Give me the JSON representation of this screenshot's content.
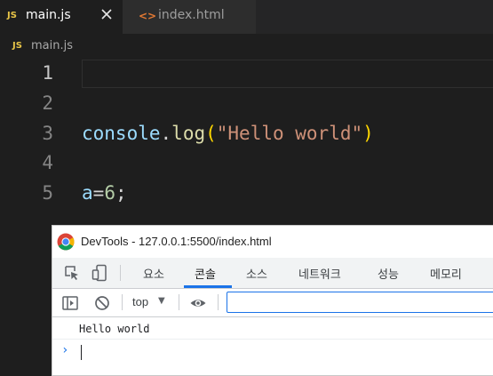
{
  "editor": {
    "tabs": [
      {
        "icon": "JS",
        "label": "main.js",
        "active": true
      },
      {
        "icon": "<>",
        "label": "index.html",
        "active": false
      }
    ],
    "breadcrumb": {
      "icon": "JS",
      "file": "main.js"
    },
    "line_numbers": [
      "1",
      "2",
      "3",
      "4",
      "5"
    ],
    "code": {
      "line3": {
        "obj": "console",
        "dot": ".",
        "fn": "log",
        "open": "(",
        "str": "\"Hello world\"",
        "close": ")"
      },
      "line5": {
        "var": "a",
        "eq": "=",
        "num": "6",
        "semi": ";"
      }
    }
  },
  "devtools": {
    "title": "DevTools - 127.0.0.1:5500/index.html",
    "tabs": [
      "요소",
      "콘솔",
      "소스",
      "네트워크",
      "성능",
      "메모리"
    ],
    "active_tab": "콘솔",
    "context": "top",
    "filter": {
      "value": "",
      "placeholder": ""
    },
    "messages": [
      "Hello world"
    ],
    "prompt": "›"
  },
  "colors": {
    "editor_bg": "#1e1e1e",
    "js_icon": "#e8c547",
    "accent": "#1a73e8"
  }
}
